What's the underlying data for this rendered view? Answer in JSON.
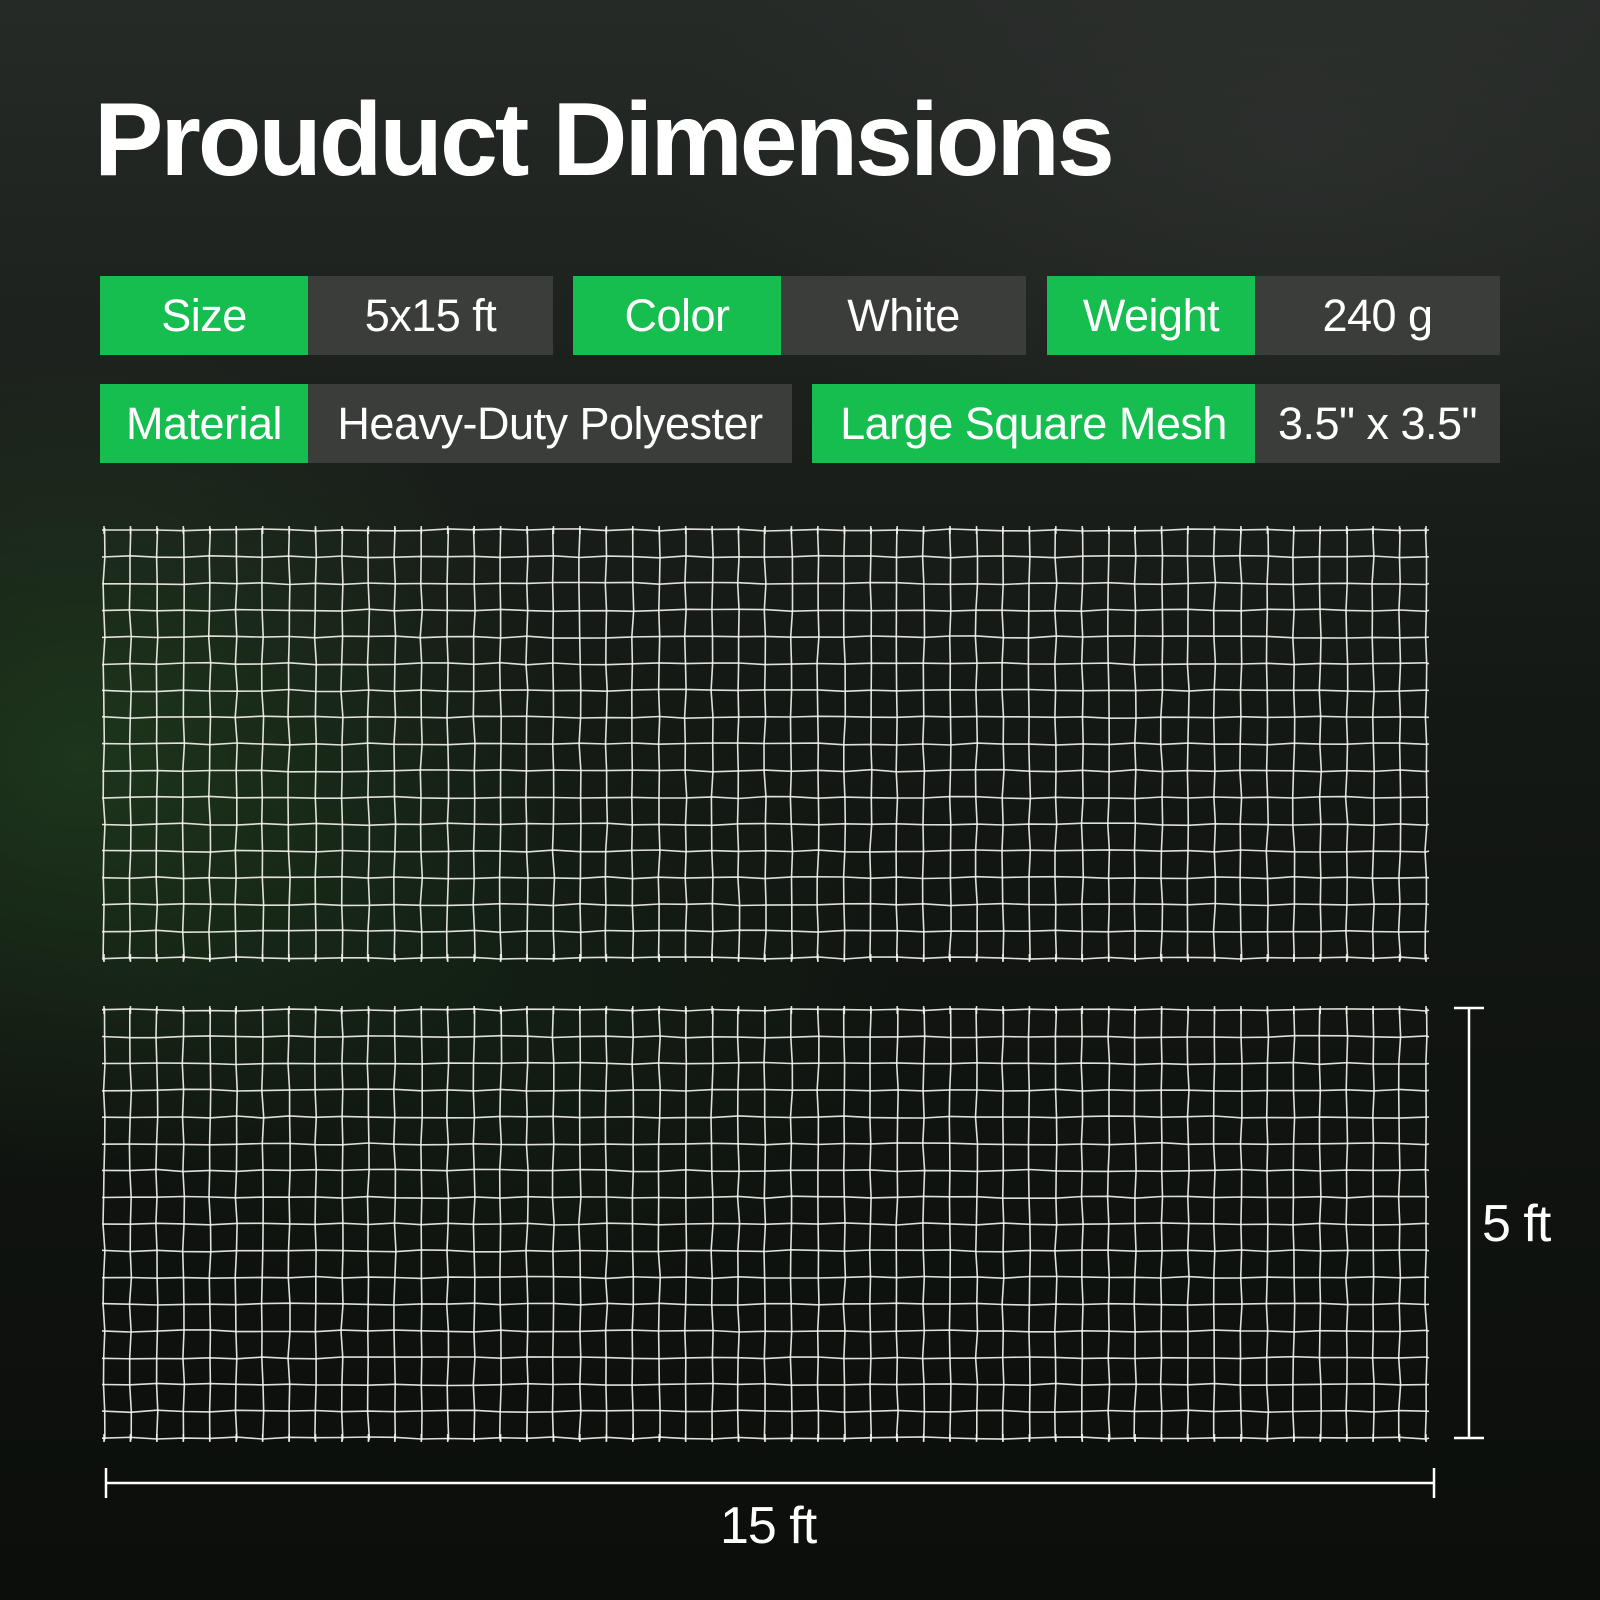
{
  "title": "Prouduct Dimensions",
  "specs": {
    "size": {
      "label": "Size",
      "value": "5x15 ft"
    },
    "color": {
      "label": "Color",
      "value": "White"
    },
    "weight": {
      "label": "Weight",
      "value": "240 g"
    },
    "material": {
      "label": "Material",
      "value": "Heavy-Duty Polyester"
    },
    "mesh": {
      "label": "Large Square Mesh",
      "value": "3.5\" x 3.5\""
    }
  },
  "dimensions": {
    "height_label": "5 ft",
    "width_label": "15 ft"
  },
  "colors": {
    "accent_green": "#16be4f",
    "value_grey": "#3b3d3b",
    "net_white": "#f2f2ec"
  }
}
